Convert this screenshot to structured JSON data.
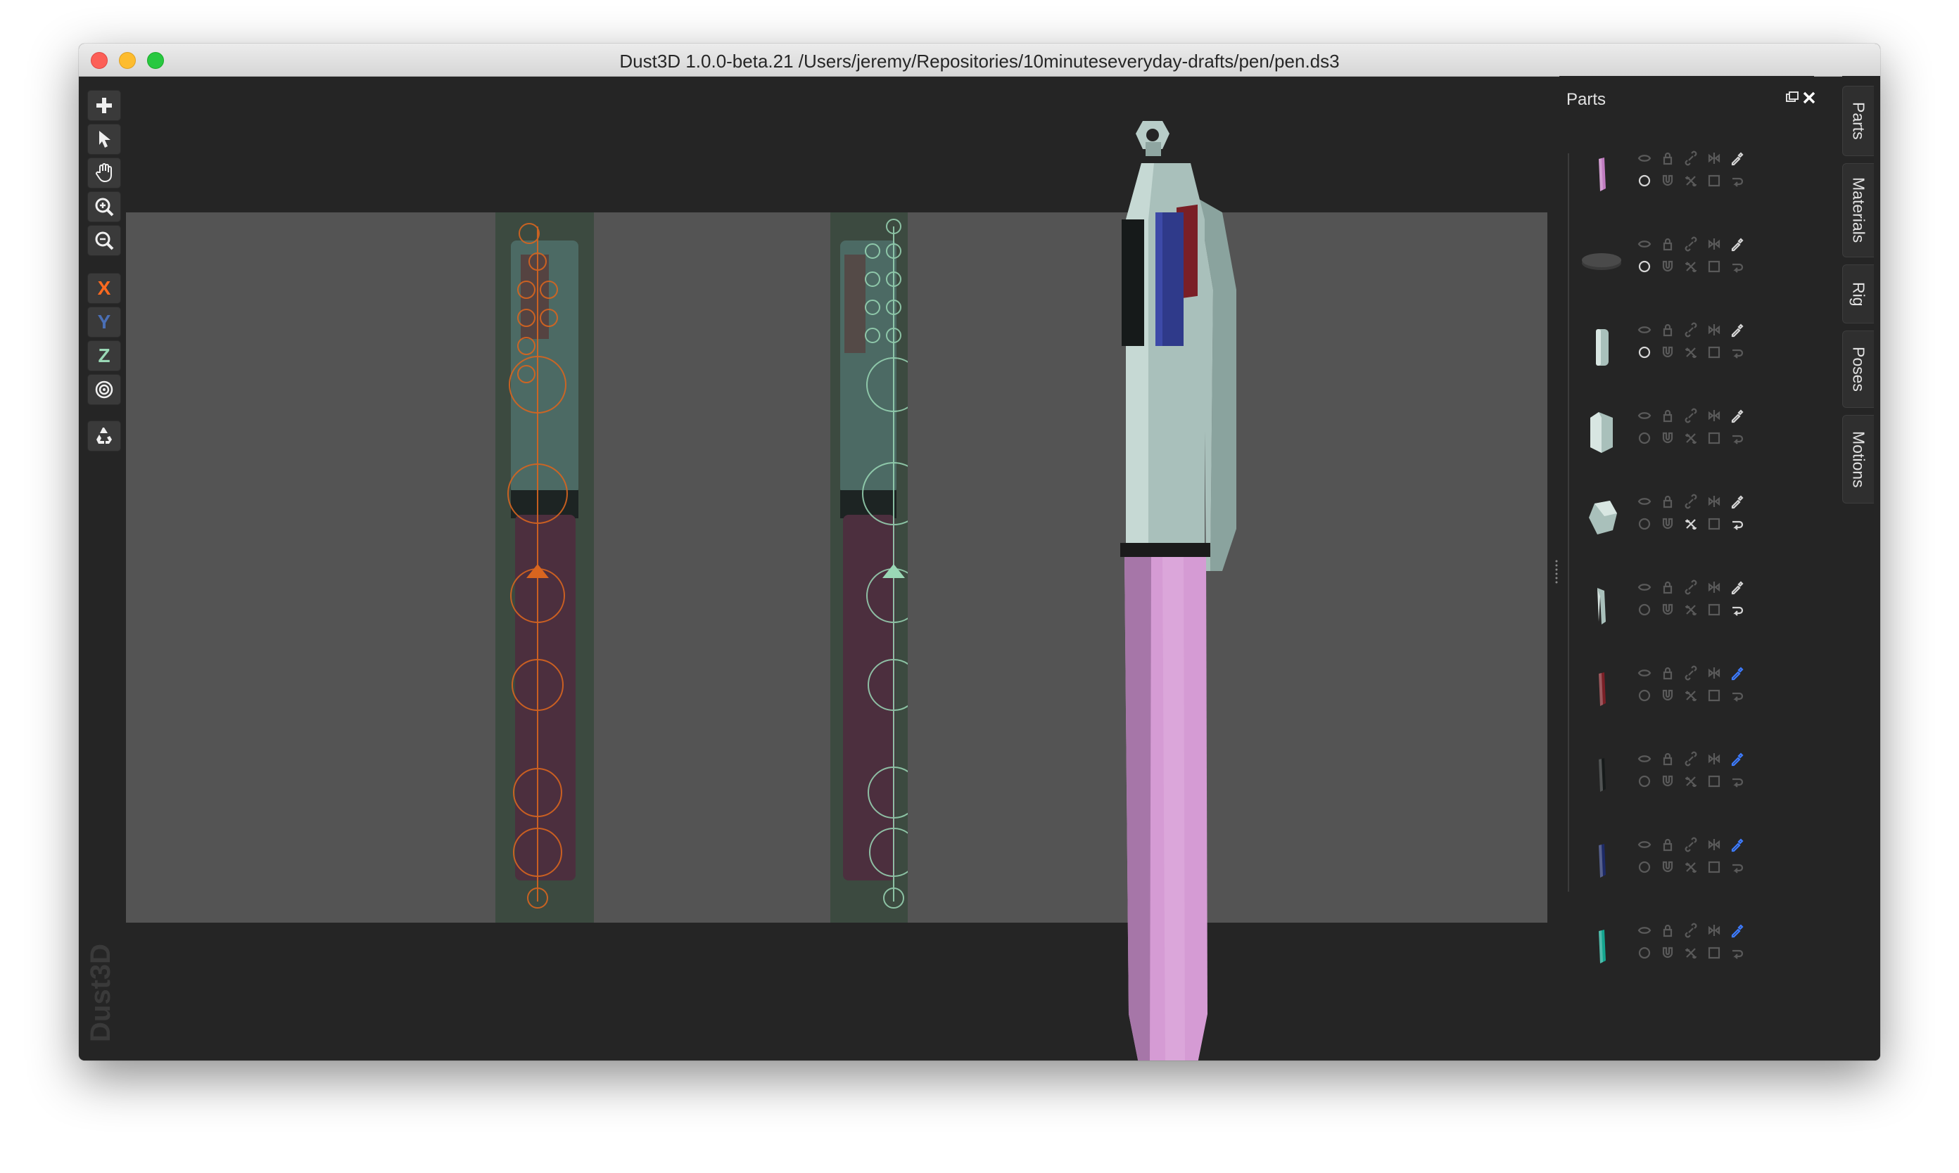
{
  "window": {
    "title": "Dust3D 1.0.0-beta.21 /Users/jeremy/Repositories/10minuteseveryday-drafts/pen/pen.ds3"
  },
  "toolbar": {
    "tools": [
      {
        "name": "add-icon"
      },
      {
        "name": "select-icon"
      },
      {
        "name": "hand-icon"
      },
      {
        "name": "zoom-in-icon"
      },
      {
        "name": "zoom-out-icon"
      }
    ],
    "axes": [
      {
        "label": "X",
        "color": "#ff6a1f"
      },
      {
        "label": "Y",
        "color": "#4a6fb5"
      },
      {
        "label": "Z",
        "color": "#9ad8b6"
      }
    ],
    "extras": [
      {
        "name": "radial-mirror-icon"
      },
      {
        "name": "recycle-icon"
      }
    ]
  },
  "watermark": "Dust3D",
  "parts_panel": {
    "title": "Parts",
    "parts": [
      {
        "color": "#c07cc0",
        "shape": "stick"
      },
      {
        "color": "#3a3a3a",
        "shape": "disc"
      },
      {
        "color": "#a9c0bb",
        "shape": "cylinder"
      },
      {
        "color": "#a9c0bb",
        "shape": "block"
      },
      {
        "color": "#a9c0bb",
        "shape": "hex"
      },
      {
        "color": "#a9c0bb",
        "shape": "clip"
      },
      {
        "color": "#7a1f26",
        "shape": "stick"
      },
      {
        "color": "#161a1a",
        "shape": "stick"
      },
      {
        "color": "#1d2a66",
        "shape": "stick"
      },
      {
        "color": "#14a58f",
        "shape": "stick"
      }
    ]
  },
  "side_tabs": [
    "Parts",
    "Materials",
    "Rig",
    "Poses",
    "Motions"
  ],
  "colors": {
    "accent_pink": "#d59bd4",
    "cap_green": "#a9c0bb",
    "pen_blue": "#2f3a8a",
    "pen_red": "#7a1f26",
    "ring_dark": "#1b1b1b"
  }
}
